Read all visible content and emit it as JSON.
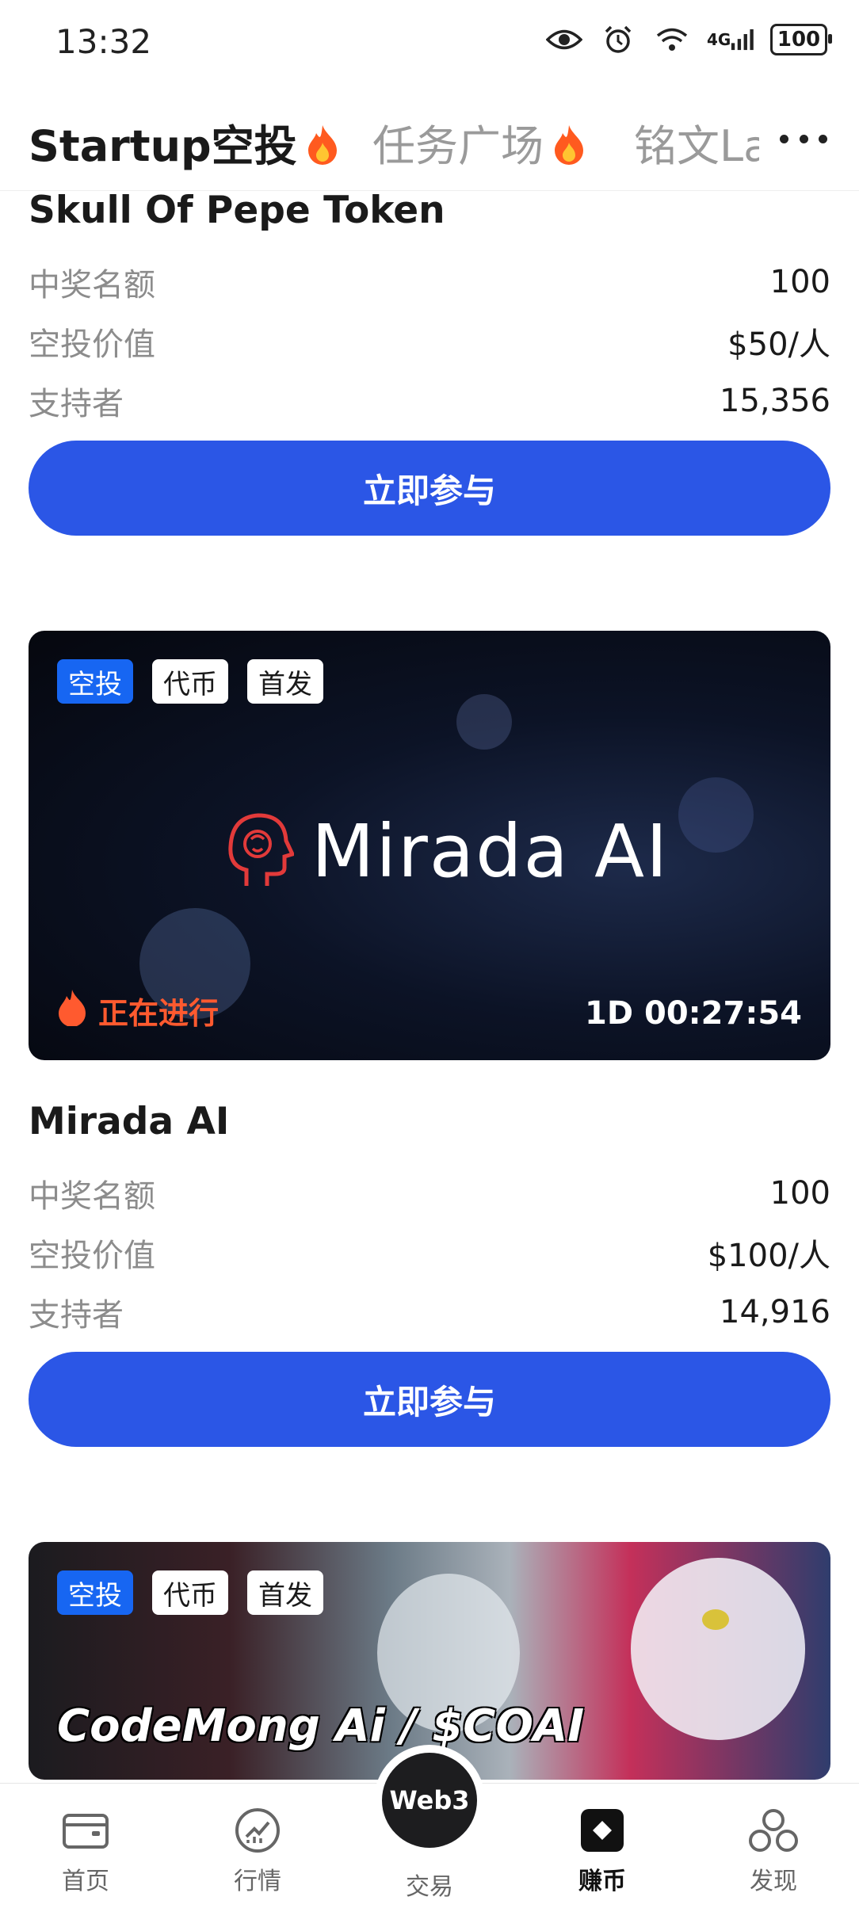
{
  "status_bar": {
    "time": "13:32",
    "network": "4G",
    "battery": "100"
  },
  "top_tabs": [
    {
      "label": "Startup空投"
    },
    {
      "label": "任务广场"
    },
    {
      "label": "铭文La"
    }
  ],
  "cards": [
    {
      "title": "Skull Of Pepe Token",
      "winners_label": "中奖名额",
      "winners_value": "100",
      "value_label": "空投价值",
      "value_value": "$50/人",
      "supporters_label": "支持者",
      "supporters_value": "15,356",
      "button_label": "立即参与"
    },
    {
      "tags": [
        "空投",
        "代币",
        "首发"
      ],
      "banner_brand": "Mirada AI",
      "status": "正在进行",
      "countdown": "1D 00:27:54",
      "title": "Mirada AI",
      "winners_label": "中奖名额",
      "winners_value": "100",
      "value_label": "空投价值",
      "value_value": "$100/人",
      "supporters_label": "支持者",
      "supporters_value": "14,916",
      "button_label": "立即参与"
    },
    {
      "tags": [
        "空投",
        "代币",
        "首发"
      ],
      "banner_title": "CodeMong Ai / $COAI"
    }
  ],
  "bottom_nav": {
    "items": [
      {
        "label": "首页",
        "icon": "wallet-icon"
      },
      {
        "label": "行情",
        "icon": "market-chart-icon"
      },
      {
        "label": "交易",
        "icon": "web3-icon"
      },
      {
        "label": "赚币",
        "icon": "earn-diamond-icon"
      },
      {
        "label": "发现",
        "icon": "discover-icon"
      }
    ],
    "web3_label": "Web3",
    "active": "赚币"
  },
  "colors": {
    "primary": "#2b56e6",
    "tag_blue": "#1766f2",
    "live_orange": "#ff5a2f"
  }
}
